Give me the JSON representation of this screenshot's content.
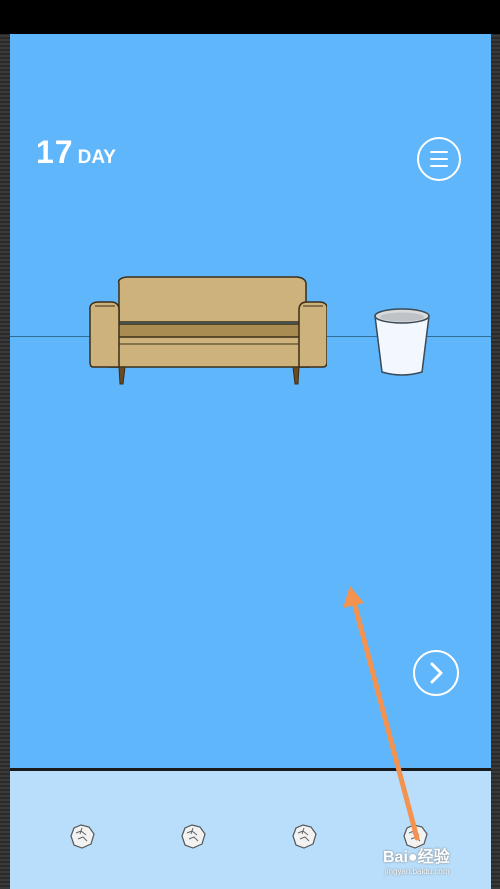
{
  "hud": {
    "day_number": "17",
    "day_label": "DAY"
  },
  "icons": {
    "menu": "hamburger-menu-icon",
    "next": "chevron-right-icon",
    "item": "crumpled-paper-icon"
  },
  "scene": {
    "objects": [
      "sofa",
      "trash-bin"
    ]
  },
  "inventory": {
    "items": [
      "crumpled-paper",
      "crumpled-paper",
      "crumpled-paper",
      "crumpled-paper"
    ]
  },
  "watermark": {
    "brand": "Bai",
    "brand_cn": "经验",
    "url": "jingyan.baidu.com"
  },
  "colors": {
    "wall": "#5fb6fb",
    "inventory_bg": "#b8defb",
    "sofa": "#cdb27c",
    "annotation_arrow": "#f4924f"
  }
}
